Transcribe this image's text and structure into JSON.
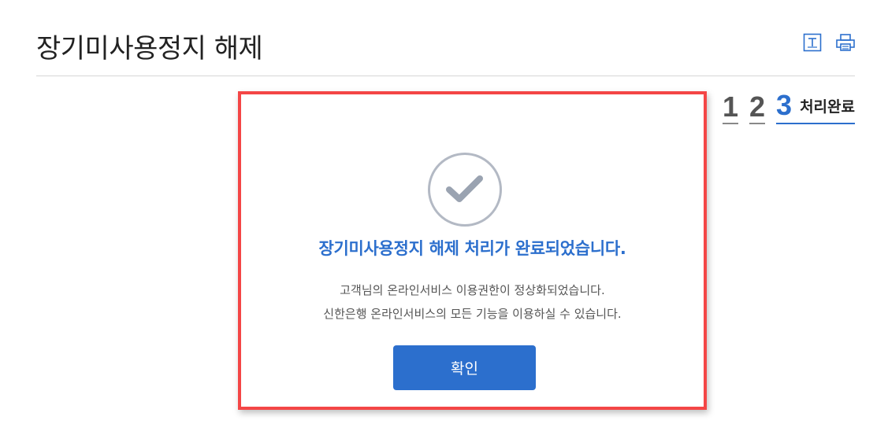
{
  "page": {
    "title": "장기미사용정지 해제",
    "tools": [
      {
        "name": "text-size-icon"
      },
      {
        "name": "print-icon"
      }
    ]
  },
  "steps": {
    "items": [
      "1",
      "2",
      "3"
    ],
    "active_index": 2,
    "active_label": "처리완료"
  },
  "dialog": {
    "heading": "장기미사용정지 해제 처리가 완료되었습니다.",
    "message_line1": "고객님의 온라인서비스 이용권한이 정상화되었습니다.",
    "message_line2": "신한은행 온라인서비스의 모든 기능을 이용하실 수 있습니다.",
    "confirm_label": "확인",
    "icon": "check-icon"
  },
  "colors": {
    "accent": "#2c6fcd",
    "highlight_border": "#f44646",
    "check_gray": "#b3b9c4"
  }
}
